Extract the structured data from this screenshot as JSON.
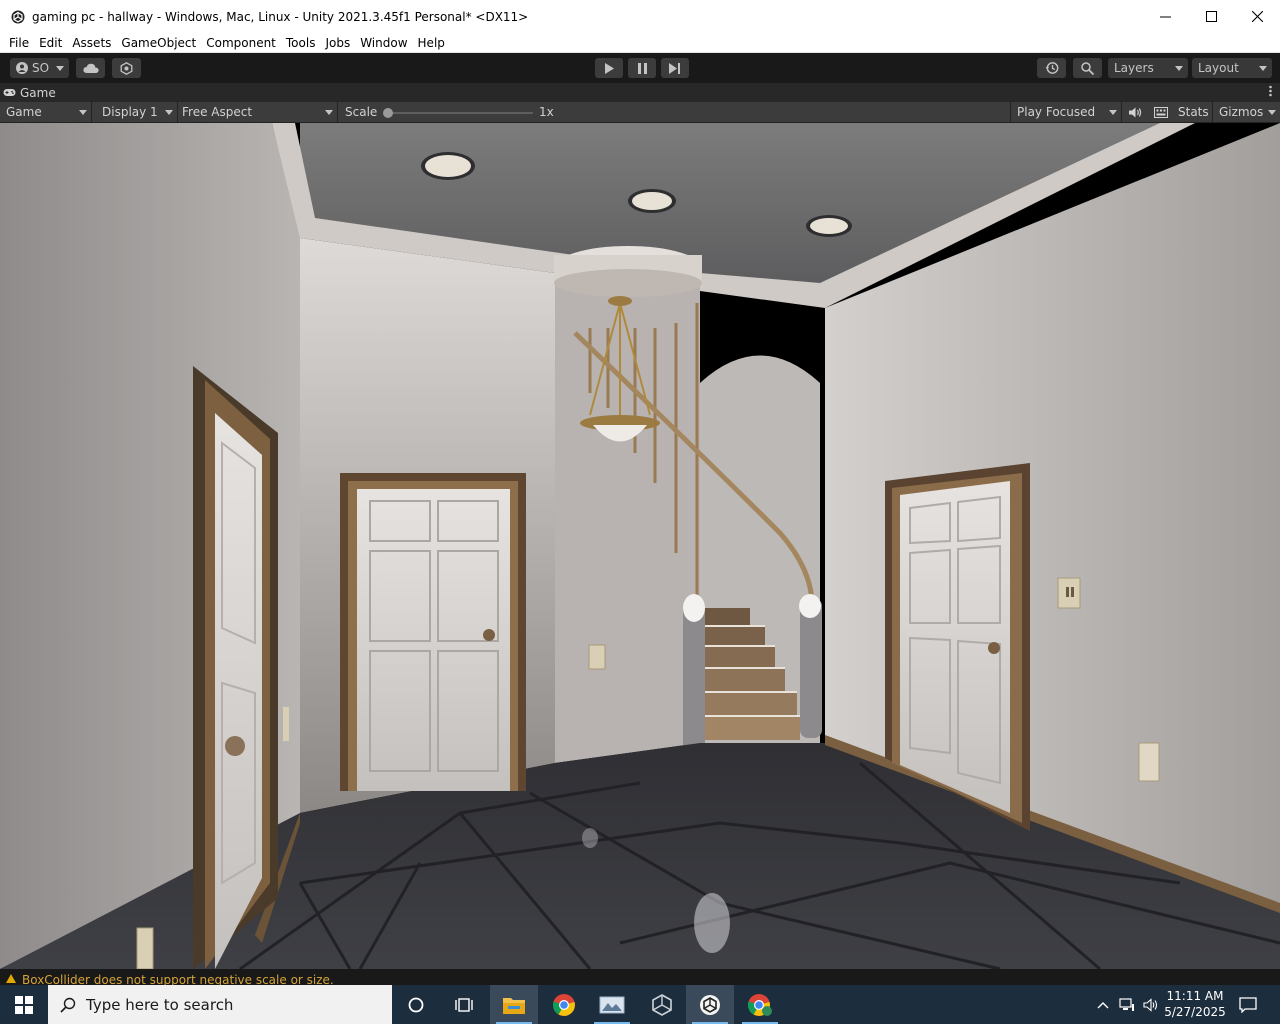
{
  "window": {
    "title": "gaming pc - hallway - Windows, Mac, Linux - Unity 2021.3.45f1 Personal* <DX11>"
  },
  "menu": [
    "File",
    "Edit",
    "Assets",
    "GameObject",
    "Component",
    "Tools",
    "Jobs",
    "Window",
    "Help"
  ],
  "toolbar": {
    "account_label": "SO",
    "layers_label": "Layers",
    "layout_label": "Layout"
  },
  "game_tab": {
    "label": "Game"
  },
  "game_bar": {
    "view_mode": "Game",
    "display": "Display 1",
    "aspect": "Free Aspect",
    "scale_label": "Scale",
    "scale_value": "1x",
    "scale_fraction": 0.0,
    "play_mode": "Play Focused",
    "stats_label": "Stats",
    "gizmos_label": "Gizmos"
  },
  "status": {
    "message": "BoxCollider does not support negative scale or size."
  },
  "taskbar": {
    "search_placeholder": "Type here to search",
    "time": "11:11 AM",
    "date": "5/27/2025",
    "apps": [
      "cortana-icon",
      "task-view-icon",
      "file-explorer-icon",
      "chrome-icon",
      "photos-icon",
      "unity-hub-icon",
      "unity-editor-icon",
      "chrome-profile-icon"
    ]
  },
  "colors": {
    "editor_dark": "#191919",
    "panel": "#3c3c3c",
    "warning": "#d4a33a",
    "taskbar": "#1c2d3e",
    "accent": "#76b9ed"
  }
}
